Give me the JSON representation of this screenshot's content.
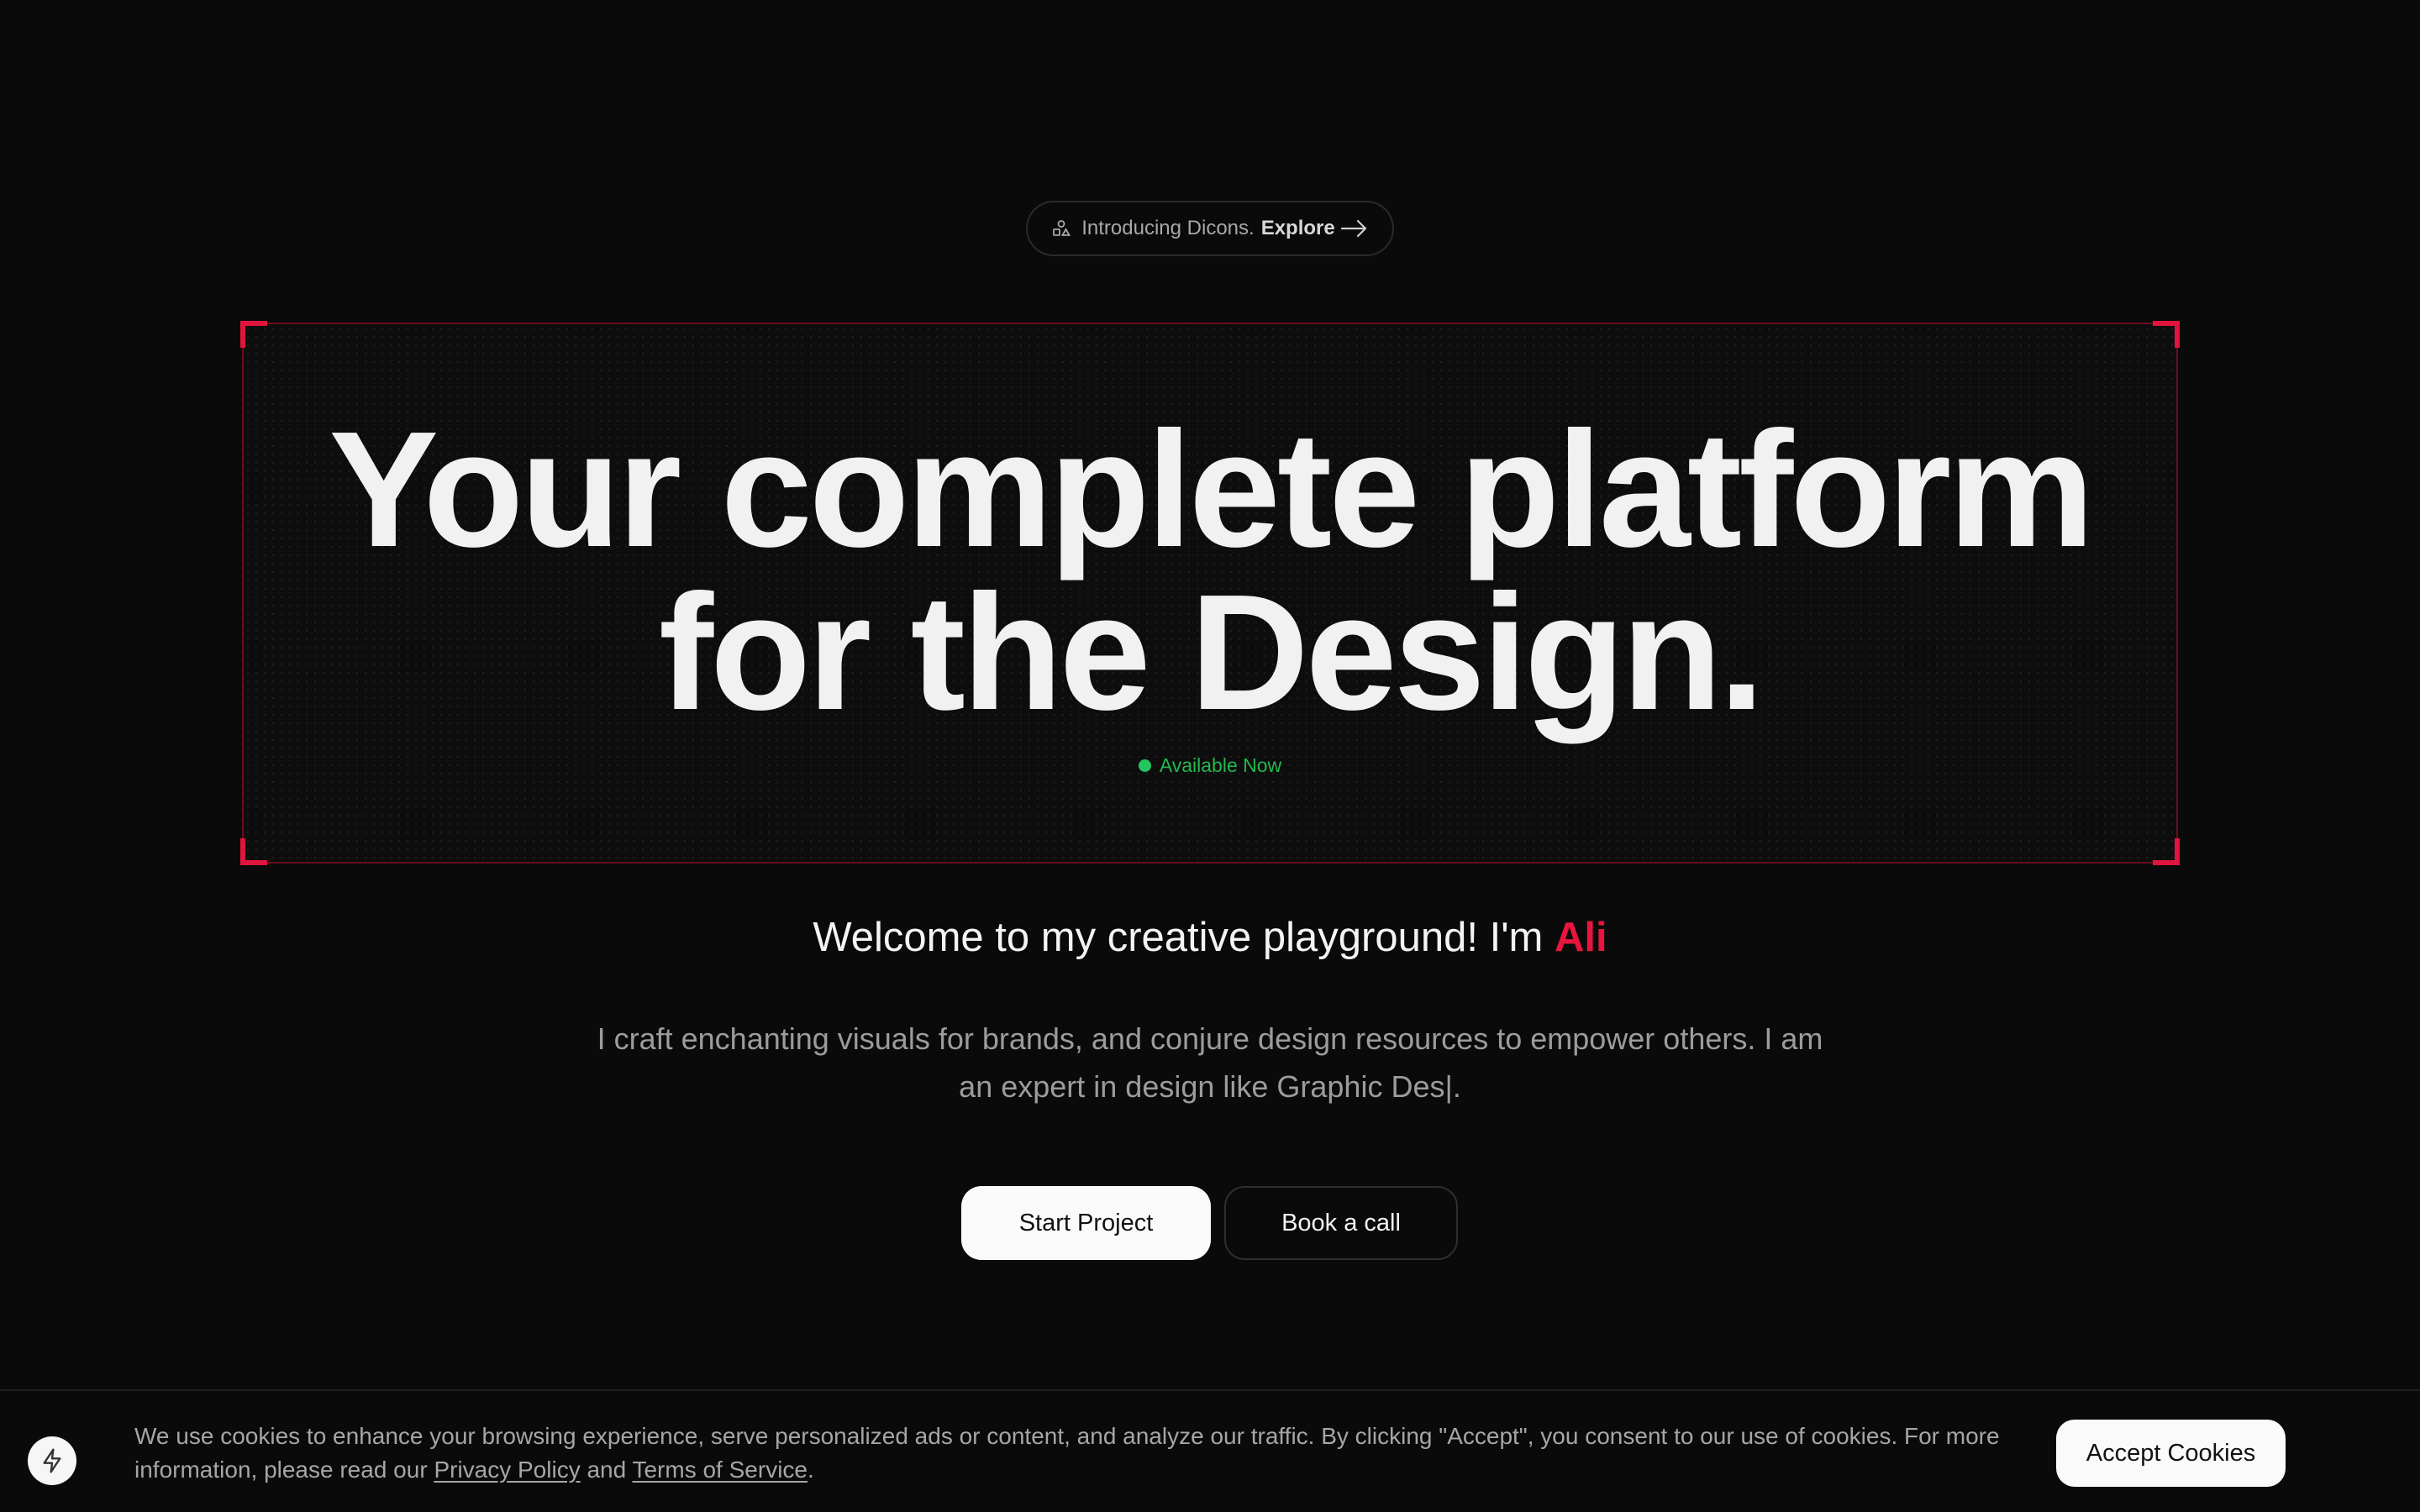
{
  "announcement": {
    "text": "Introducing Dicons.",
    "link_label": "Explore",
    "icon": "shapes-icon"
  },
  "hero": {
    "headline_line1": "Your complete platform",
    "headline_line2": "for the Design.",
    "status": "Available Now"
  },
  "intro": {
    "welcome": "Welcome to my creative playground! I'm",
    "name": "Ali",
    "bio": "I craft enchanting visuals for brands, and conjure design resources to empower others. I am an expert in design like Graphic Des|."
  },
  "actions": {
    "primary_label": "Start Project",
    "secondary_label": "Book a call"
  },
  "cookie": {
    "text_before": "We use cookies to enhance your browsing experience, serve personalized ads or content, and analyze our traffic. By clicking \"Accept\", you consent to our use of cookies. For more information, please read our",
    "privacy_label": "Privacy Policy",
    "and_text": "and",
    "terms_label": "Terms of Service",
    "period": ".",
    "accept_label": "Accept Cookies",
    "icon": "lightning-icon"
  },
  "colors": {
    "background": "#0b0a0a",
    "accent": "#e8153f",
    "status_green": "#22c55e",
    "frame_border": "#6b0c1f"
  }
}
